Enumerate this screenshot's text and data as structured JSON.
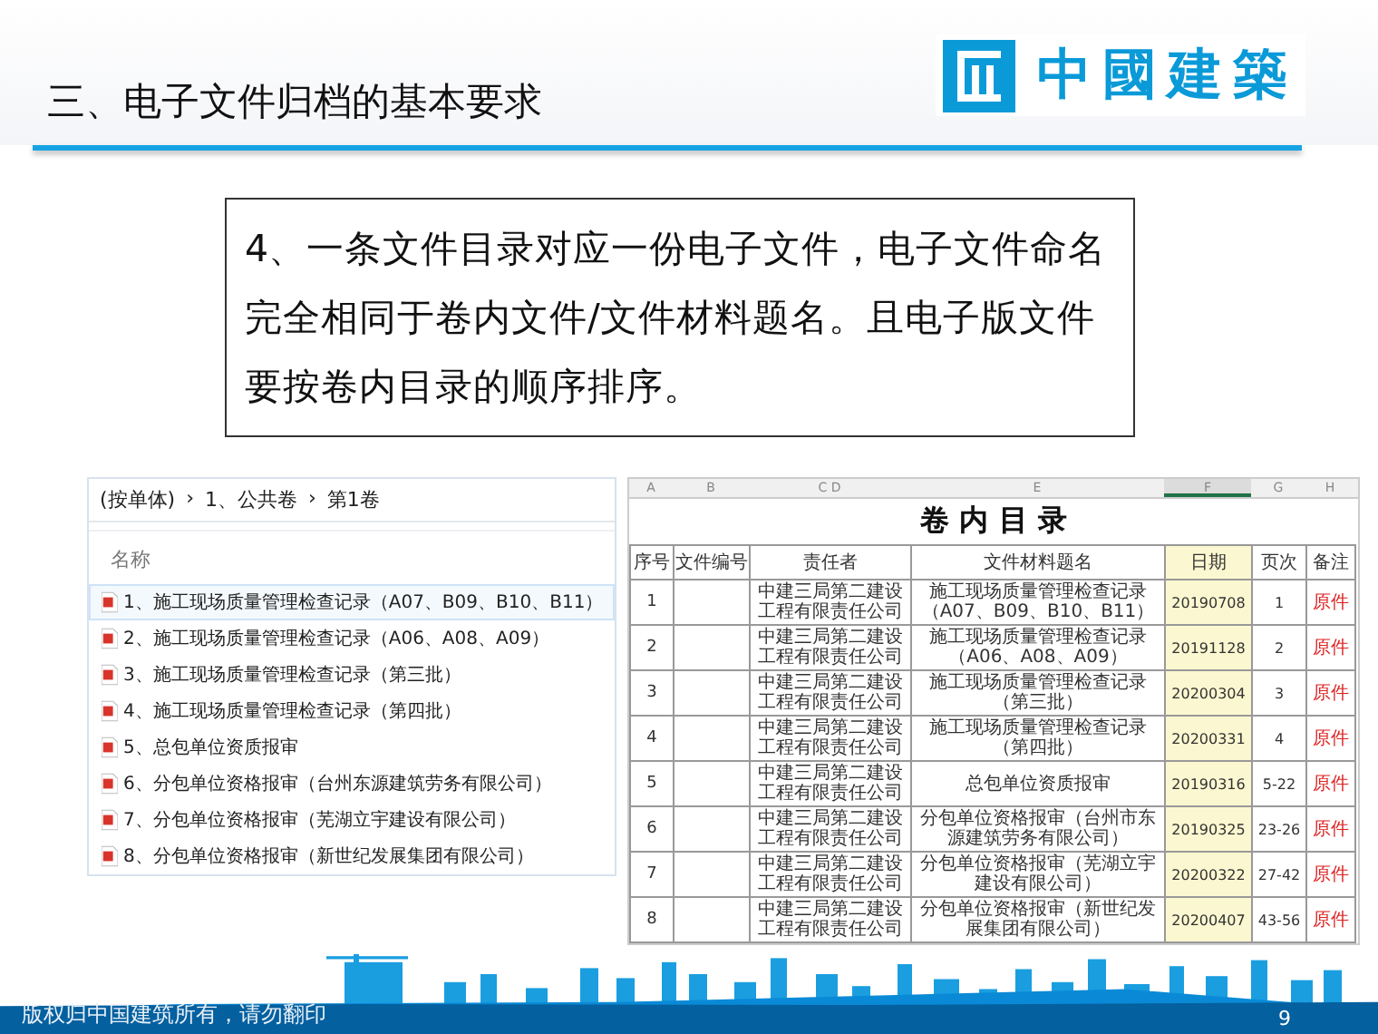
{
  "header": {
    "title": "三、电子文件归档的基本要求",
    "logo_text": "中國建築"
  },
  "requirement": "4、一条文件目录对应一份电子文件，电子文件命名完全相同于卷内文件/文件材料题名。且电子版文件要按卷内目录的顺序排序。",
  "explorer": {
    "breadcrumb": [
      "(按单体)",
      "›",
      "1、公共卷",
      "›",
      "第1卷"
    ],
    "column_header": "名称",
    "files": [
      {
        "name": "1、施工现场质量管理检查记录（A07、B09、B10、B11）",
        "selected": true
      },
      {
        "name": "2、施工现场质量管理检查记录（A06、A08、A09）",
        "selected": false
      },
      {
        "name": "3、施工现场质量管理检查记录（第三批）",
        "selected": false
      },
      {
        "name": "4、施工现场质量管理检查记录（第四批）",
        "selected": false
      },
      {
        "name": "5、总包单位资质报审",
        "selected": false
      },
      {
        "name": "6、分包单位资格报审（台州东源建筑劳务有限公司）",
        "selected": false
      },
      {
        "name": "7、分包单位资格报审（芜湖立宇建设有限公司）",
        "selected": false
      },
      {
        "name": "8、分包单位资格报审（新世纪发展集团有限公司）",
        "selected": false
      }
    ]
  },
  "sheet": {
    "column_letters": [
      "A",
      "B",
      "C D",
      "E",
      "F",
      "G",
      "H"
    ],
    "title": "卷 内 目 录",
    "columns": [
      {
        "label": "序号",
        "selected": false
      },
      {
        "label": "文件编号",
        "selected": false
      },
      {
        "label": "责任者",
        "selected": false
      },
      {
        "label": "文件材料题名",
        "selected": false
      },
      {
        "label": "日期",
        "selected": true
      },
      {
        "label": "页次",
        "selected": false
      },
      {
        "label": "备注",
        "selected": false
      }
    ],
    "rows": [
      {
        "no": "1",
        "owner": "中建三局第二建设工程有限责任公司",
        "title": "施工现场质量管理检查记录（A07、B09、B10、B11）",
        "date": "20190708",
        "pages": "1",
        "note": "原件"
      },
      {
        "no": "2",
        "owner": "中建三局第二建设工程有限责任公司",
        "title": "施工现场质量管理检查记录（A06、A08、A09）",
        "date": "20191128",
        "pages": "2",
        "note": "原件"
      },
      {
        "no": "3",
        "owner": "中建三局第二建设工程有限责任公司",
        "title": "施工现场质量管理检查记录（第三批）",
        "date": "20200304",
        "pages": "3",
        "note": "原件"
      },
      {
        "no": "4",
        "owner": "中建三局第二建设工程有限责任公司",
        "title": "施工现场质量管理检查记录（第四批）",
        "date": "20200331",
        "pages": "4",
        "note": "原件"
      },
      {
        "no": "5",
        "owner": "中建三局第二建设工程有限责任公司",
        "title": "总包单位资质报审",
        "date": "20190316",
        "pages": "5-22",
        "note": "原件"
      },
      {
        "no": "6",
        "owner": "中建三局第二建设工程有限责任公司",
        "title": "分包单位资格报审（台州市东源建筑劳务有限公司）",
        "date": "20190325",
        "pages": "23-26",
        "note": "原件"
      },
      {
        "no": "7",
        "owner": "中建三局第二建设工程有限责任公司",
        "title": "分包单位资格报审（芜湖立宇建设有限公司）",
        "date": "20200322",
        "pages": "27-42",
        "note": "原件"
      },
      {
        "no": "8",
        "owner": "中建三局第二建设工程有限责任公司",
        "title": "分包单位资格报审（新世纪发展集团有限公司）",
        "date": "20200407",
        "pages": "43-56",
        "note": "原件"
      }
    ]
  },
  "footer": {
    "copyright": "版权归中国建筑所有，请勿翻印",
    "page_number": "9"
  }
}
